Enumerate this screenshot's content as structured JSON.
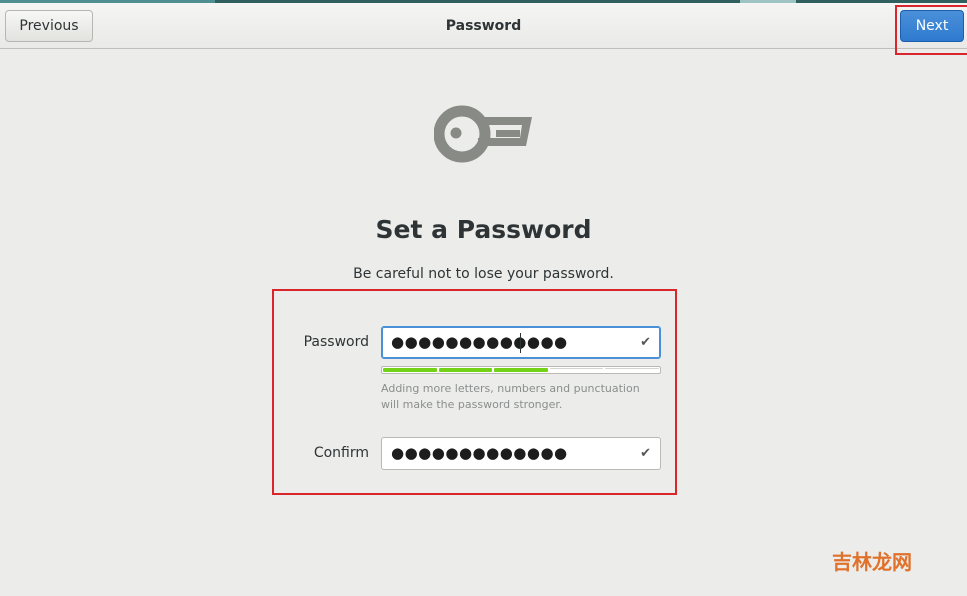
{
  "header": {
    "previous_label": "Previous",
    "title": "Password",
    "next_label": "Next"
  },
  "main": {
    "icon": "key-icon",
    "heading": "Set a Password",
    "subtitle": "Be careful not to lose your password."
  },
  "form": {
    "password": {
      "label": "Password",
      "value_masked": "●●●●●●●●●●●●●",
      "valid_icon": "check-icon"
    },
    "strength": {
      "blocks_filled": 3,
      "blocks_total": 5,
      "color": "#73d216"
    },
    "hint": "Adding more letters, numbers and punctuation will make the password stronger.",
    "confirm": {
      "label": "Confirm",
      "value_masked": "●●●●●●●●●●●●●",
      "valid_icon": "check-icon"
    }
  },
  "watermark": "吉林龙网",
  "colors": {
    "accent": "#4a90d9",
    "annotation": "#d9262c",
    "background": "#ececea"
  }
}
